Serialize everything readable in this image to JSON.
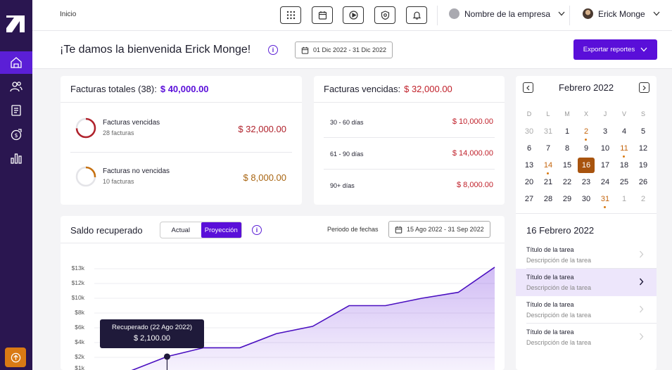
{
  "topbar": {
    "breadcrumb": "Inicio",
    "icons": [
      "apps-grid-icon",
      "calendar-icon",
      "play-icon",
      "settings-icon",
      "bell-icon"
    ],
    "company": "Nombre de la empresa",
    "user": "Erick Monge"
  },
  "header": {
    "welcome": "¡Te damos la bienvenida Erick Monge!",
    "date_range": "01 Dic 2022 - 31 Dic 2022",
    "export_label": "Exportar reportes"
  },
  "sidebar": {
    "items": [
      "home-icon",
      "users-icon",
      "receipt-icon",
      "money-icon",
      "chart-icon"
    ],
    "bottom": "upload-icon"
  },
  "facturas_totales": {
    "title": "Facturas totales",
    "count": "(38):",
    "amount": "$ 40,000.00",
    "rows": [
      {
        "title": "Facturas vencidas",
        "sub": "28 facturas",
        "amount": "$ 32,000.00",
        "color": "#b0222c",
        "fraction": 0.74
      },
      {
        "title": "Facturas no vencidas",
        "sub": "10 facturas",
        "amount": "$ 8,000.00",
        "color": "#c6700f",
        "fraction": 0.26
      }
    ]
  },
  "facturas_vencidas": {
    "title": "Facturas vencidas:",
    "amount": "$ 32,000.00",
    "rows": [
      {
        "label": "30 - 60 días",
        "amount": "$ 10,000.00"
      },
      {
        "label": "61 - 90 días",
        "amount": "$ 14,000.00"
      },
      {
        "label": "90+ días",
        "amount": "$ 8,000.00"
      }
    ]
  },
  "calendar": {
    "month": "Febrero 2022",
    "dow": [
      "D",
      "L",
      "M",
      "X",
      "J",
      "V",
      "S"
    ],
    "weeks": [
      [
        "30",
        "31",
        "1",
        "2",
        "3",
        "4",
        "5"
      ],
      [
        "6",
        "7",
        "8",
        "9",
        "10",
        "11",
        "12"
      ],
      [
        "13",
        "14",
        "15",
        "16",
        "17",
        "18",
        "19"
      ],
      [
        "20",
        "21",
        "22",
        "23",
        "24",
        "25",
        "26"
      ],
      [
        "27",
        "28",
        "29",
        "30",
        "31",
        "1",
        "2"
      ]
    ],
    "selected_date": "16 Febrero 2022",
    "tasks": [
      {
        "title": "Título de la tarea",
        "desc": "Descripción de la tarea"
      },
      {
        "title": "Título de la tarea",
        "desc": "Descripción de la tarea"
      },
      {
        "title": "Título de la tarea",
        "desc": "Descripción de la tarea"
      },
      {
        "title": "Título de la tarea",
        "desc": "Descripción de la tarea"
      }
    ]
  },
  "saldo": {
    "title": "Saldo recuperado",
    "toggle": [
      "Actual",
      "Proyección"
    ],
    "period_label": "Periodo de fechas",
    "period_range": "15 Ago 2022 - 31 Sep 2022",
    "tooltip_title": "Recuperado (22 Ago 2022)",
    "tooltip_value": "$ 2,100.00"
  },
  "chart_data": {
    "type": "area",
    "title": "Saldo recuperado",
    "yticks": [
      "$1k",
      "$2k",
      "$4k",
      "$6k",
      "$8k",
      "$10k",
      "$12k",
      "$13k"
    ],
    "ylim": [
      0,
      13000
    ],
    "x": [
      0,
      1,
      2,
      3,
      4,
      5,
      6,
      7,
      8,
      9,
      10,
      11
    ],
    "values": [
      300,
      800,
      2100,
      3300,
      3300,
      5200,
      6200,
      9000,
      9000,
      10000,
      10800,
      13100
    ],
    "highlight_index": 2,
    "color": "#5a0fd9"
  }
}
